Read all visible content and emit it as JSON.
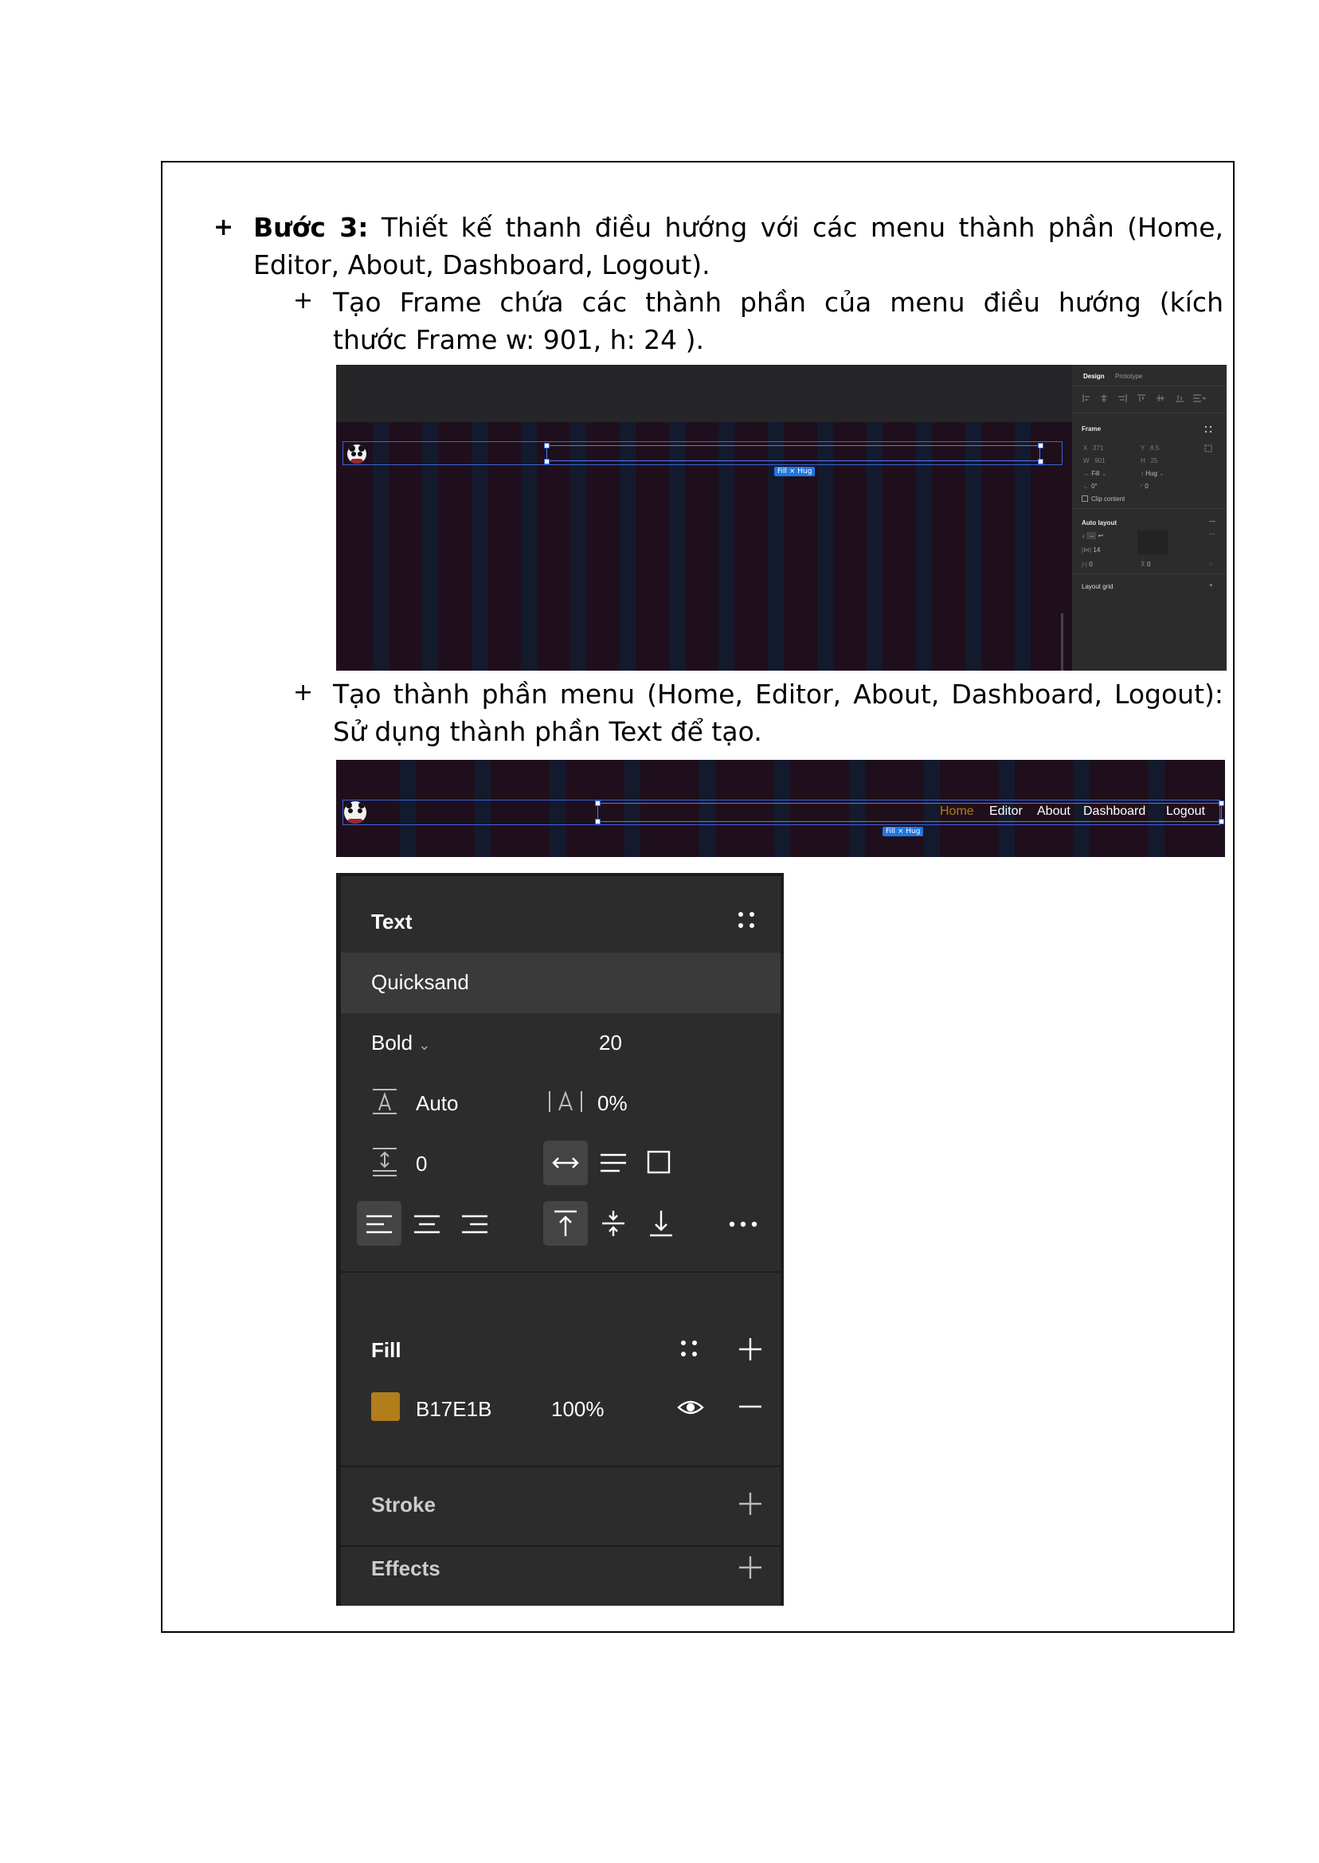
{
  "step": {
    "bullet": "+",
    "label": "Bước 3:",
    "line1_rest": "Thiết kế thanh điều hướng với các menu thành phần (Home,",
    "line2": "Editor, About, Dashboard, Logout)."
  },
  "sub1": {
    "bullet": "+",
    "line1": "Tạo Frame chứa các thành phần của menu điều hướng (kích",
    "line2": "thước Frame w: 901, h: 24 )."
  },
  "sub2": {
    "bullet": "+",
    "line1": "Tạo thành phần menu (Home, Editor, About, Dashboard, Logout):",
    "line2": "Sử dụng thành phần Text để tạo."
  },
  "shot1": {
    "badge": "Fill × Hug",
    "panel": {
      "tab_design": "Design",
      "tab_prototype": "Prototype",
      "frame_label": "Frame",
      "x_label": "X",
      "x_value": "371",
      "y_label": "Y",
      "y_value": "8.5",
      "w_label": "W",
      "w_value": "901",
      "h_label": "H",
      "h_value": "25",
      "fill_label": "Fill",
      "hug_label": "Hug",
      "rotation": "0°",
      "radius": "0",
      "clip_content": "Clip content",
      "auto_layout": "Auto layout",
      "gap": "14",
      "pad_h": "0",
      "pad_v": "0",
      "layout_grid": "Layout grid"
    }
  },
  "shot2": {
    "badge": "Fill × Hug",
    "menu": [
      "Home",
      "Editor",
      "About",
      "Dashboard",
      "Logout"
    ],
    "active_color": "#B17E1B"
  },
  "text_panel": {
    "title": "Text",
    "font_family": "Quicksand",
    "font_weight": "Bold",
    "font_size": "20",
    "line_height": "Auto",
    "letter_spacing": "0%",
    "paragraph_spacing": "0",
    "fill_title": "Fill",
    "fill_hex": "B17E1B",
    "fill_opacity": "100%",
    "fill_color": "#B17E1B",
    "stroke_title": "Stroke",
    "effects_title": "Effects"
  }
}
